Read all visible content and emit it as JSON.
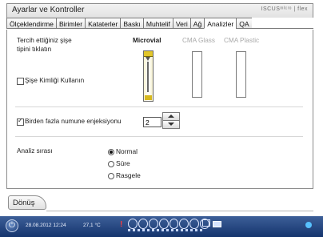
{
  "window": {
    "title": "Ayarlar ve Kontroller",
    "brand": "ISCUSᵐᴵᶜʳᵒ | flex"
  },
  "tabs": [
    {
      "label": "Ölçeklendirme"
    },
    {
      "label": "Birimler"
    },
    {
      "label": "Kataterler"
    },
    {
      "label": "Baskı"
    },
    {
      "label": "Muhtelif"
    },
    {
      "label": "Veri"
    },
    {
      "label": "Ağ"
    },
    {
      "label": "Analizler",
      "active": true
    },
    {
      "label": "QA"
    }
  ],
  "panel": {
    "vial_prompt_line1": "Tercih ettiğiniz şişe",
    "vial_prompt_line2": "tipini tıklatın",
    "vial_types": [
      {
        "label": "Microvial",
        "selected": true
      },
      {
        "label": "CMA Glass",
        "selected": false
      },
      {
        "label": "CMA Plastic",
        "selected": false
      }
    ],
    "use_bottle_id_label": "Şişe Kimliği Kullanın",
    "use_bottle_id_checked": false,
    "multi_injection_label": "Birden fazla numune enjeksiyonu",
    "multi_injection_checked": true,
    "injection_count": "2",
    "analysis_order_label": "Analiz sırası",
    "analysis_order_options": [
      {
        "label": "Normal",
        "checked": true
      },
      {
        "label": "Süre",
        "checked": false
      },
      {
        "label": "Rasgele",
        "checked": false
      }
    ]
  },
  "footer": {
    "back_label": "Dönüş"
  },
  "statusbar": {
    "datetime": "28.08.2012 12:24",
    "temperature": "27,1 °C",
    "warning": "!"
  },
  "colors": {
    "statusbar_top": "#3d5f98",
    "statusbar_bottom": "#14346d",
    "vial_cap": "#e2c62a",
    "warning": "#ff3b3b"
  }
}
